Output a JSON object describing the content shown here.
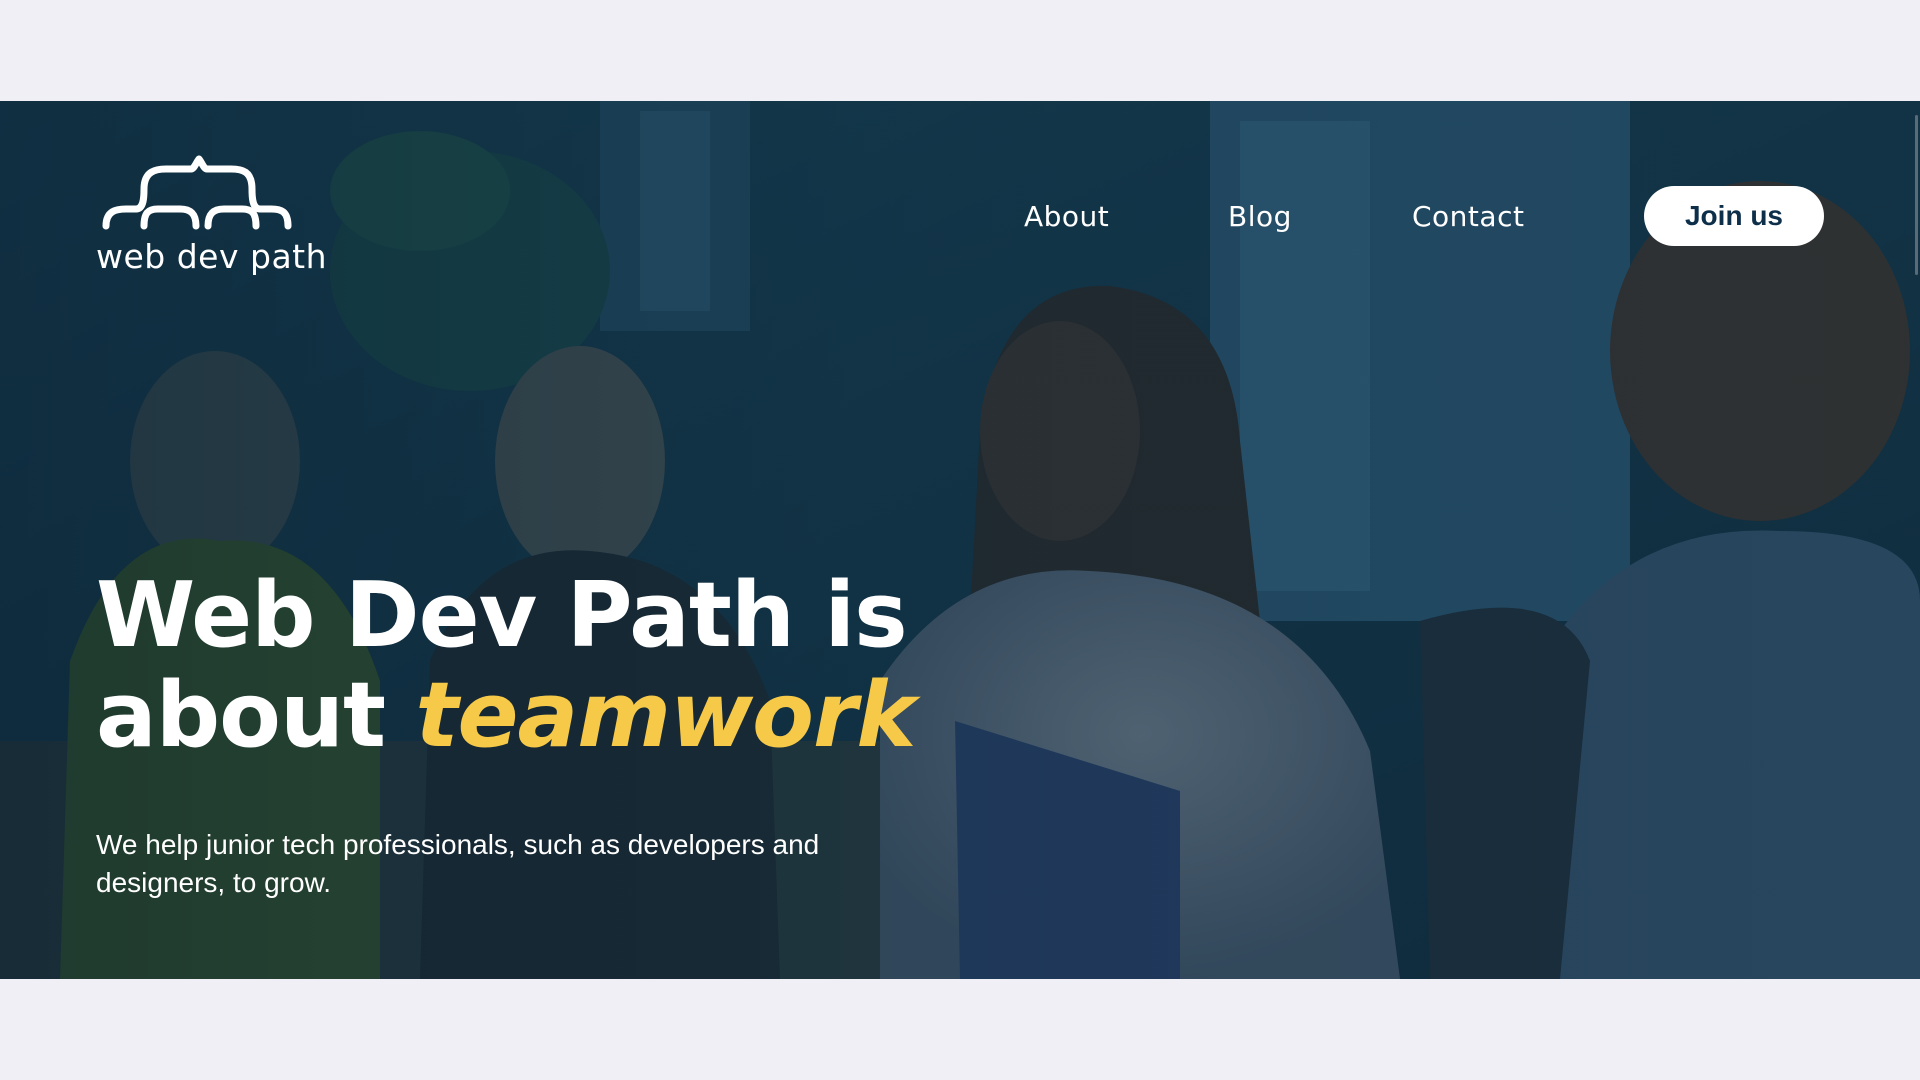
{
  "brand": {
    "logo_text": "web dev path"
  },
  "nav": {
    "about": "About",
    "blog": "Blog",
    "contact": "Contact",
    "join": "Join us"
  },
  "hero": {
    "headline_line1": "Web Dev Path is",
    "headline_line2_prefix": "about",
    "headline_accent": "teamwork",
    "subtext": "We help junior tech professionals, such as developers and designers, to grow."
  },
  "colors": {
    "overlay": "#163a4f",
    "accent": "#f7c948",
    "button_text": "#0d2f4a",
    "page_background": "#efeff5"
  },
  "icons": {
    "logo": "web-dev-path-logo-icon"
  }
}
